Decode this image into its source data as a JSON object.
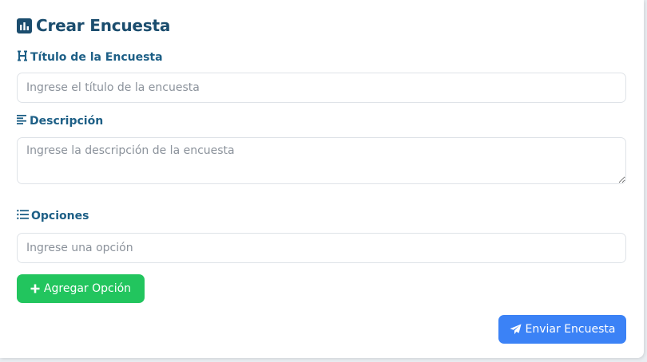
{
  "form": {
    "title": "Crear Encuesta",
    "title_icon": "bar-chart-icon",
    "fields": {
      "survey_title": {
        "label": "Título de la Encuesta",
        "icon": "heading-icon",
        "placeholder": "Ingrese el título de la encuesta",
        "value": ""
      },
      "description": {
        "label": "Descripción",
        "icon": "align-left-icon",
        "placeholder": "Ingrese la descripción de la encuesta",
        "value": ""
      },
      "options": {
        "label": "Opciones",
        "icon": "list-icon",
        "placeholder": "Ingrese una opción",
        "value": ""
      }
    },
    "add_option_button": {
      "label": "Agregar Opción",
      "icon": "plus-icon",
      "color": "#22c55e"
    },
    "submit_button": {
      "label": "Enviar Encuesta",
      "icon": "paper-plane-icon",
      "color": "#3b82f6"
    },
    "colors": {
      "title": "#1b4d6e",
      "label": "#1d5f86"
    }
  }
}
